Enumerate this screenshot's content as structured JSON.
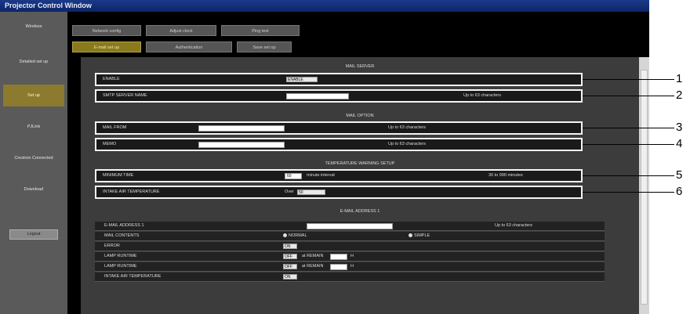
{
  "window": {
    "title": "Projector Control Window"
  },
  "sidebar": {
    "items": [
      {
        "label": "Wireless"
      },
      {
        "label": "Detailed set up"
      },
      {
        "label": "Set up"
      },
      {
        "label": "PJLink"
      },
      {
        "label": "Crestron Connected"
      },
      {
        "label": "Download"
      }
    ],
    "button_label": "Logout"
  },
  "tabs": {
    "row1": [
      "Network config",
      "Adjust clock",
      "Ping test"
    ],
    "row2": [
      "E-mail set up",
      "Authentication",
      "Save set up"
    ]
  },
  "mail_server": {
    "title": "MAIL SERVER",
    "enable_label": "ENABLE",
    "enable_value": "ENABLE",
    "smtp_label": "SMTP SERVER NAME",
    "smtp_hint": "Up to 63 characters"
  },
  "mail_option": {
    "title": "MAIL OPTION",
    "from_label": "MAIL FROM",
    "from_hint": "Up to 63 characters",
    "memo_label": "MEMO",
    "memo_hint": "Up to 63 characters"
  },
  "temperature_warning": {
    "title": "TEMPERATURE WARNING SETUP",
    "interval_label": "MINIMUM TIME",
    "interval_value": "60",
    "interval_unit": "minute interval",
    "interval_hint": "30 to 990 minutes",
    "temp_label": "INTAKE AIR TEMPERATURE",
    "temp_prefix": "Over",
    "temp_value": "50"
  },
  "email_address": {
    "title": "E-MAIL ADDRESS 1",
    "address_label": "E-MAIL ADDRESS 1",
    "address_hint": "Up to 63 characters",
    "rows": [
      {
        "label": "MAIL CONTENTS",
        "opt1": "NORMAL",
        "opt2": "SIMPLE"
      },
      {
        "label": "ERROR",
        "sel": "ON"
      },
      {
        "label": "LAMP RUNTIME",
        "sel": "OFF",
        "mid": "at REMAIN",
        "unit": "H"
      },
      {
        "label": "LAMP RUNTIME",
        "sel": "OFF",
        "mid": "at REMAIN",
        "unit": "H"
      },
      {
        "label": "INTAKE AIR TEMPERATURE",
        "sel": "ON"
      }
    ]
  },
  "callouts": [
    "1",
    "2",
    "3",
    "4",
    "5",
    "6"
  ]
}
